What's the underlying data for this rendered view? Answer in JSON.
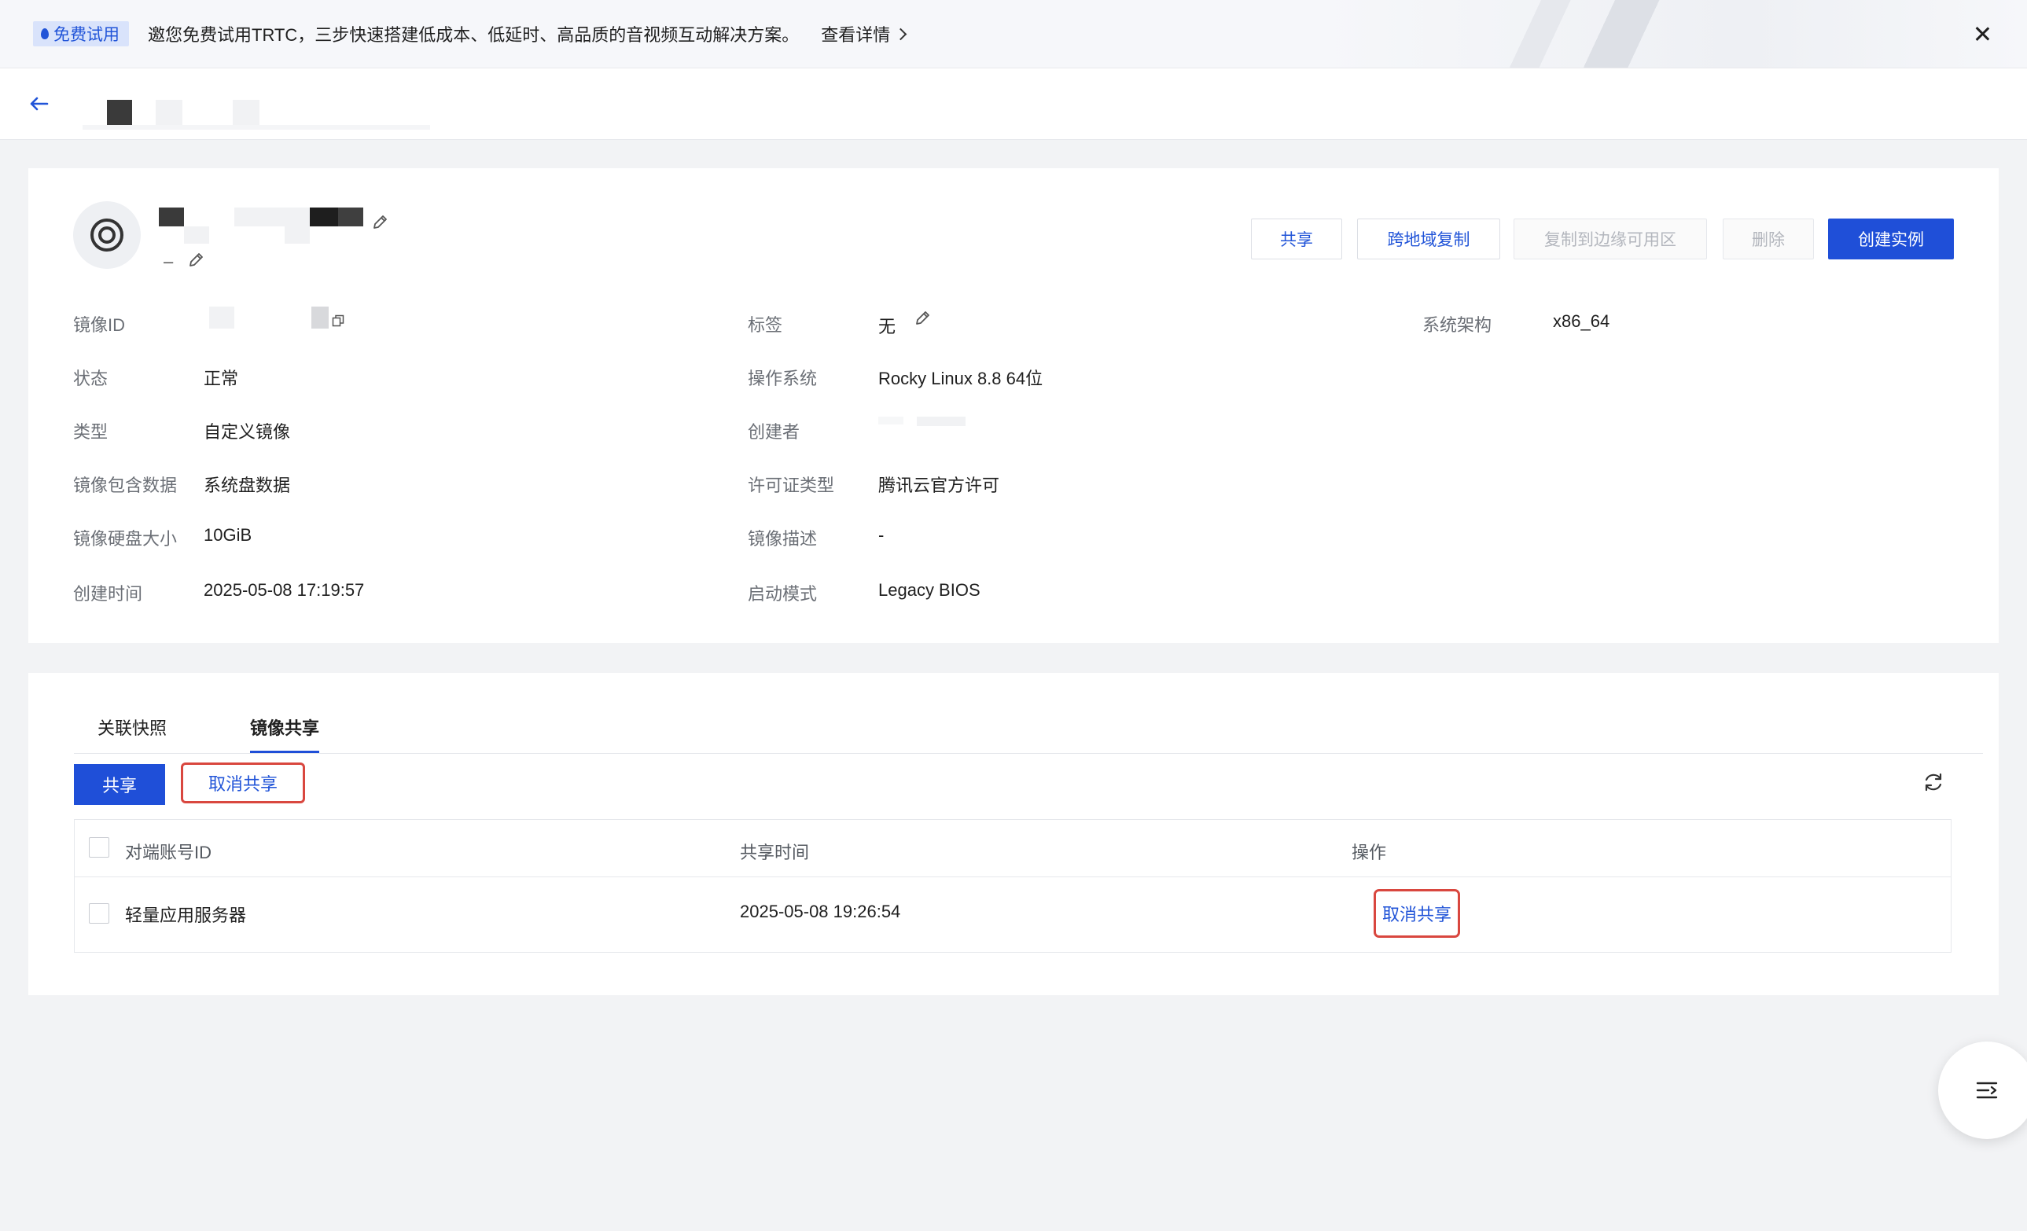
{
  "banner": {
    "tag": "免费试用",
    "text": "邀您免费试用TRTC，三步快速搭建低成本、低延时、高品质的音视频互动解决方案。",
    "link": "查看详情"
  },
  "image_card": {
    "subtitle_dash": "–",
    "actions": {
      "share": "共享",
      "cross_region_copy": "跨地域复制",
      "copy_to_edge": "复制到边缘可用区",
      "delete": "删除",
      "create_instance": "创建实例"
    },
    "fields": {
      "image_id_label": "镜像ID",
      "status_label": "状态",
      "status_value": "正常",
      "type_label": "类型",
      "type_value": "自定义镜像",
      "included_data_label": "镜像包含数据",
      "included_data_value": "系统盘数据",
      "disk_size_label": "镜像硬盘大小",
      "disk_size_value": "10GiB",
      "created_time_label": "创建时间",
      "created_time_value": "2025-05-08 17:19:57",
      "tag_label": "标签",
      "tag_value": "无",
      "os_label": "操作系统",
      "os_value": "Rocky Linux 8.8 64位",
      "creator_label": "创建者",
      "license_label": "许可证类型",
      "license_value": "腾讯云官方许可",
      "description_label": "镜像描述",
      "description_value": "-",
      "boot_mode_label": "启动模式",
      "boot_mode_value": "Legacy BIOS",
      "arch_label": "系统架构",
      "arch_value": "x86_64"
    }
  },
  "share_card": {
    "tabs": [
      "关联快照",
      "镜像共享"
    ],
    "active_tab": "镜像共享",
    "share_button": "共享",
    "unshare_button": "取消共享",
    "table": {
      "columns": [
        "对端账号ID",
        "共享时间",
        "操作"
      ],
      "rows": [
        {
          "account": "轻量应用服务器",
          "time": "2025-05-08 19:26:54",
          "action": "取消共享"
        }
      ]
    }
  }
}
